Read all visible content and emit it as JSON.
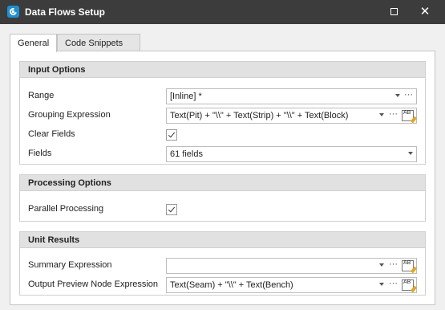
{
  "window": {
    "title": "Data Flows Setup",
    "maximize_glyph": "□",
    "close_glyph": "✕"
  },
  "tabs": [
    {
      "label": "General"
    },
    {
      "label": "Code Snippets"
    }
  ],
  "input_options": {
    "header": "Input Options",
    "range": {
      "label": "Range",
      "value": "[Inline] *"
    },
    "grouping": {
      "label": "Grouping Expression",
      "value": "Text(Pit) + \"\\\\\" + Text(Strip) + \"\\\\\" + Text(Block)"
    },
    "clear_fields": {
      "label": "Clear Fields",
      "checked": true
    },
    "fields": {
      "label": "Fields",
      "value": "61 fields"
    }
  },
  "processing_options": {
    "header": "Processing Options",
    "parallel": {
      "label": "Parallel Processing",
      "checked": true
    }
  },
  "unit_results": {
    "header": "Unit Results",
    "summary": {
      "label": "Summary Expression",
      "value": ""
    },
    "output_preview": {
      "label": "Output Preview Node Expression",
      "value": "Text(Seam) + \"\\\\\" + Text(Bench)"
    }
  },
  "icons": {
    "ellipsis": "···",
    "editor_icon_text": "AB",
    "colors": {
      "titlebar": "#3c3c3c",
      "accent": "#1e8fd0",
      "group_header": "#e1e1e1"
    }
  }
}
